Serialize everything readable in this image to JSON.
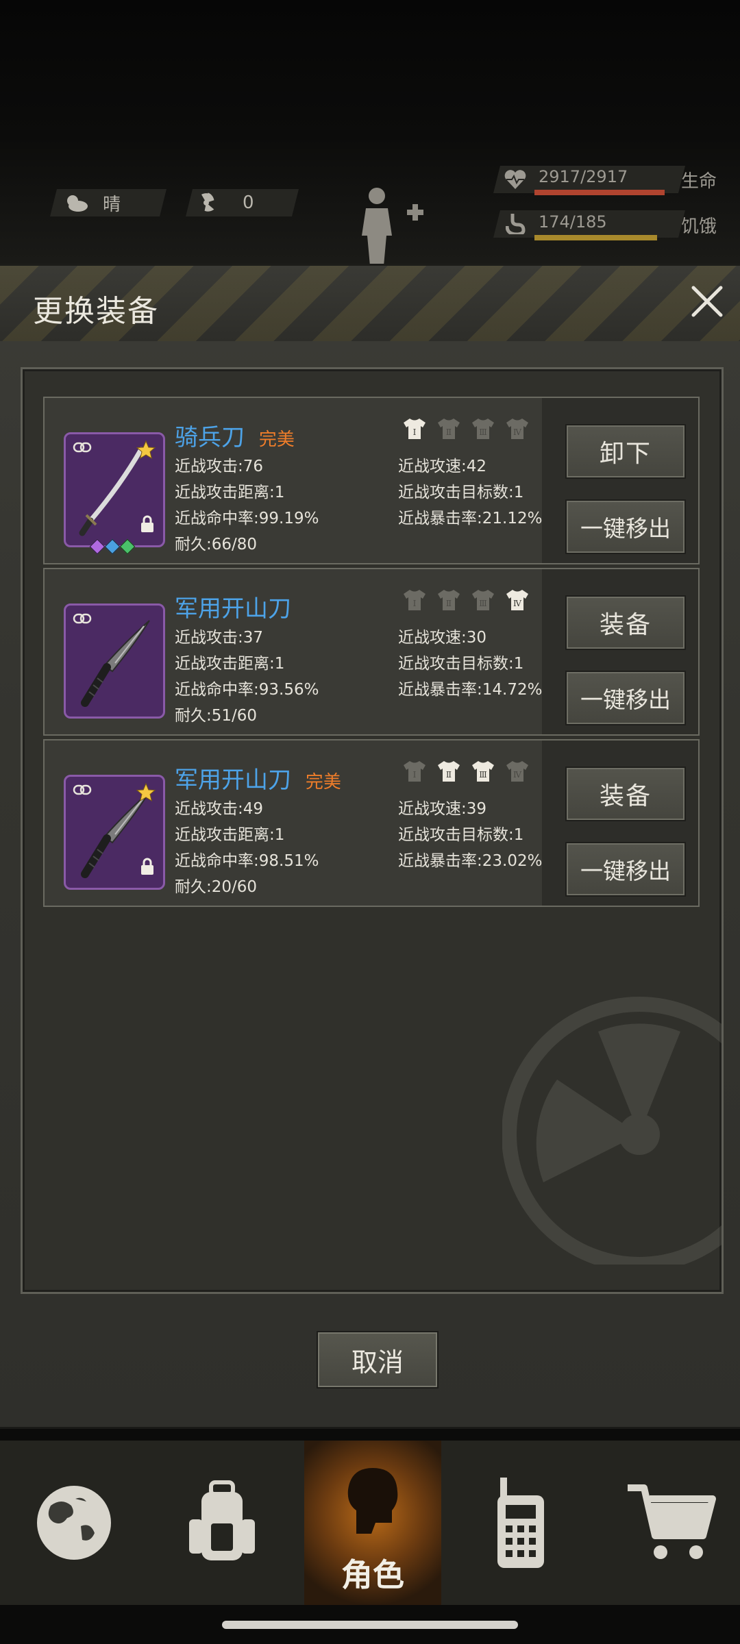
{
  "status": {
    "weather_label": "晴",
    "radiation_value": "0",
    "health_value": "2917/2917",
    "health_label": "生命",
    "hunger_value": "174/185",
    "hunger_label": "饥饿",
    "health_fraction": 1.0,
    "hunger_fraction": 0.94
  },
  "modal": {
    "title": "更换装备",
    "close_icon": "close-icon",
    "cancel_label": "取消"
  },
  "items": [
    {
      "name": "骑兵刀",
      "quality": "完美",
      "stats": {
        "attack": "近战攻击:76",
        "speed": "近战攻速:42",
        "range": "近战攻击距离:1",
        "targets": "近战攻击目标数:1",
        "hit": "近战命中率:99.19%",
        "crit": "近战暴击率:21.12%",
        "durability": "耐久:66/80"
      },
      "tiers_active": [
        true,
        false,
        false,
        false
      ],
      "btn_primary": "卸下",
      "btn_secondary": "一键移出",
      "starred": true,
      "locked": true,
      "gems": true
    },
    {
      "name": "军用开山刀",
      "quality": "",
      "stats": {
        "attack": "近战攻击:37",
        "speed": "近战攻速:30",
        "range": "近战攻击距离:1",
        "targets": "近战攻击目标数:1",
        "hit": "近战命中率:93.56%",
        "crit": "近战暴击率:14.72%",
        "durability": "耐久:51/60"
      },
      "tiers_active": [
        false,
        false,
        false,
        true
      ],
      "btn_primary": "装备",
      "btn_secondary": "一键移出",
      "starred": false,
      "locked": false,
      "gems": false
    },
    {
      "name": "军用开山刀",
      "quality": "完美",
      "stats": {
        "attack": "近战攻击:49",
        "speed": "近战攻速:39",
        "range": "近战攻击距离:1",
        "targets": "近战攻击目标数:1",
        "hit": "近战命中率:98.51%",
        "crit": "近战暴击率:23.02%",
        "durability": "耐久:20/60"
      },
      "tiers_active": [
        false,
        true,
        true,
        false
      ],
      "btn_primary": "装备",
      "btn_secondary": "一键移出",
      "starred": true,
      "locked": true,
      "gems": false
    }
  ],
  "tier_labels": [
    "Ⅰ",
    "Ⅱ",
    "Ⅲ",
    "Ⅳ"
  ],
  "nav": {
    "items": [
      "world-icon",
      "backpack-icon",
      "character-icon",
      "radio-icon",
      "cart-icon"
    ],
    "active_label": "角色"
  }
}
